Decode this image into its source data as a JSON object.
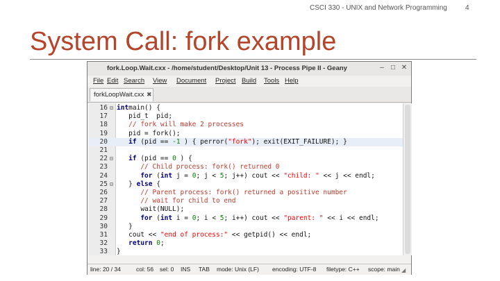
{
  "slide": {
    "header": "CSCI 330 - UNIX and Network Programming",
    "page": "4",
    "title": "System Call: fork example"
  },
  "window": {
    "title": "fork.Loop.Wait.cxx - /home/student/Desktop/Unit 13 - Process Pipe II - Geany",
    "controls": {
      "minimize": "–",
      "maximize": "□",
      "close": "✕"
    }
  },
  "menu": [
    "File",
    "Edit",
    "Search",
    "View",
    "Document",
    "Project",
    "Build",
    "Tools",
    "Help"
  ],
  "tab": {
    "label": "forkLoopWait.cxx",
    "close_icon": "✖"
  },
  "editor": {
    "current_line_index": 4,
    "lines": [
      {
        "n": "16",
        "fold": "⊟",
        "parts": [
          [
            "kw",
            "int"
          ],
          [
            "",
            "main() {"
          ]
        ]
      },
      {
        "n": "17",
        "fold": "",
        "parts": [
          [
            "",
            "   pid_t  pid;"
          ]
        ]
      },
      {
        "n": "18",
        "fold": "",
        "parts": [
          [
            "cm",
            "   // fork will make 2 processes"
          ]
        ]
      },
      {
        "n": "19",
        "fold": "",
        "parts": [
          [
            "",
            "   pid = fork();"
          ]
        ]
      },
      {
        "n": "20",
        "fold": "",
        "parts": [
          [
            "kw",
            "   if"
          ],
          [
            "",
            " (pid == "
          ],
          [
            "nm",
            "-1"
          ],
          [
            "",
            " ) { perror("
          ],
          [
            "st",
            "\"fork\""
          ],
          [
            "",
            "); exit(EXIT_FAILURE); }"
          ]
        ]
      },
      {
        "n": "21",
        "fold": "",
        "parts": [
          [
            "",
            ""
          ]
        ]
      },
      {
        "n": "22",
        "fold": "⊟",
        "parts": [
          [
            "kw",
            "   if"
          ],
          [
            "",
            " (pid == "
          ],
          [
            "nm",
            "0"
          ],
          [
            "",
            " ) {"
          ]
        ]
      },
      {
        "n": "23",
        "fold": "",
        "parts": [
          [
            "cm",
            "      // Child process: fork() returned 0"
          ]
        ]
      },
      {
        "n": "24",
        "fold": "",
        "parts": [
          [
            "kw",
            "      for"
          ],
          [
            "",
            " ("
          ],
          [
            "kw",
            "int"
          ],
          [
            "",
            " j = "
          ],
          [
            "nm",
            "0"
          ],
          [
            "",
            "; j < "
          ],
          [
            "nm",
            "5"
          ],
          [
            "",
            "; j++) cout << "
          ],
          [
            "st",
            "\"child: \""
          ],
          [
            "",
            " << j << endl;"
          ]
        ]
      },
      {
        "n": "25",
        "fold": "⊟",
        "parts": [
          [
            "",
            "   } "
          ],
          [
            "kw",
            "else"
          ],
          [
            "",
            " {"
          ]
        ]
      },
      {
        "n": "26",
        "fold": "",
        "parts": [
          [
            "cm",
            "      // Parent process: fork() returned a positive number"
          ]
        ]
      },
      {
        "n": "27",
        "fold": "",
        "parts": [
          [
            "cm",
            "      // wait for child to end"
          ]
        ]
      },
      {
        "n": "28",
        "fold": "",
        "parts": [
          [
            "",
            "      wait(NULL);"
          ]
        ]
      },
      {
        "n": "29",
        "fold": "",
        "parts": [
          [
            "kw",
            "      for"
          ],
          [
            "",
            " ("
          ],
          [
            "kw",
            "int"
          ],
          [
            "",
            " i = "
          ],
          [
            "nm",
            "0"
          ],
          [
            "",
            "; i < "
          ],
          [
            "nm",
            "5"
          ],
          [
            "",
            "; i++) cout << "
          ],
          [
            "st",
            "\"parent: \""
          ],
          [
            "",
            " << i << endl;"
          ]
        ]
      },
      {
        "n": "30",
        "fold": "",
        "parts": [
          [
            "",
            "   }"
          ]
        ]
      },
      {
        "n": "31",
        "fold": "",
        "parts": [
          [
            "",
            "   cout << "
          ],
          [
            "st",
            "\"end of process:\""
          ],
          [
            "",
            " << getpid() << endl;"
          ]
        ]
      },
      {
        "n": "32",
        "fold": "",
        "parts": [
          [
            "kw",
            "   return"
          ],
          [
            "",
            " "
          ],
          [
            "nm",
            "0"
          ],
          [
            "",
            ";"
          ]
        ]
      },
      {
        "n": "33",
        "fold": "",
        "parts": [
          [
            "",
            "}"
          ]
        ]
      }
    ]
  },
  "status": [
    {
      "label": "line: 20 / 34"
    },
    {
      "label": "col: 56"
    },
    {
      "label": "sel: 0"
    },
    {
      "label": "INS"
    },
    {
      "label": "TAB"
    },
    {
      "label": "mode: Unix (LF)"
    },
    {
      "label": "encoding: UTF-8"
    },
    {
      "label": "filetype: C++"
    },
    {
      "label": "scope: main"
    }
  ],
  "colors": {
    "title": "#b5442a",
    "keyword": "#00007f",
    "comment": "#c0392b",
    "string": "#ff0000",
    "number": "#007f00",
    "current_line": "#e8eef7"
  }
}
